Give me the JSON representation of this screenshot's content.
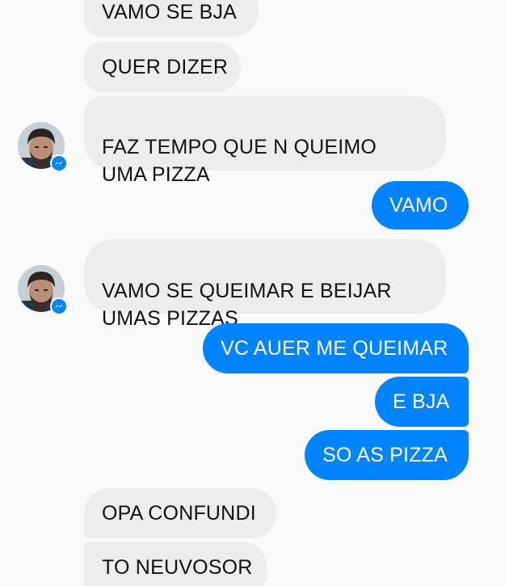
{
  "conversation": {
    "messages": [
      {
        "from": "them",
        "text": "VAMO SE BJA"
      },
      {
        "from": "them",
        "text": "QUER DIZER"
      },
      {
        "from": "them",
        "text": "FAZ TEMPO QUE N QUEIMO\nUMA PIZZA"
      },
      {
        "from": "me",
        "text": "VAMO"
      },
      {
        "from": "them",
        "text": "VAMO SE QUEIMAR E BEIJAR\nUMAS PIZZAS"
      },
      {
        "from": "me",
        "text": "VC AUER ME QUEIMAR"
      },
      {
        "from": "me",
        "text": "E BJA"
      },
      {
        "from": "me",
        "text": "SO AS PIZZA"
      },
      {
        "from": "them",
        "text": "OPA CONFUNDI"
      },
      {
        "from": "them",
        "text": "TO NEUVOSOR"
      }
    ]
  },
  "contact": {
    "avatar_icon": "contact-avatar",
    "badge_icon": "messenger-badge-icon"
  },
  "colors": {
    "incoming_bubble": "#eceded",
    "outgoing_bubble": "#0083ff",
    "background": "#fafafa"
  }
}
